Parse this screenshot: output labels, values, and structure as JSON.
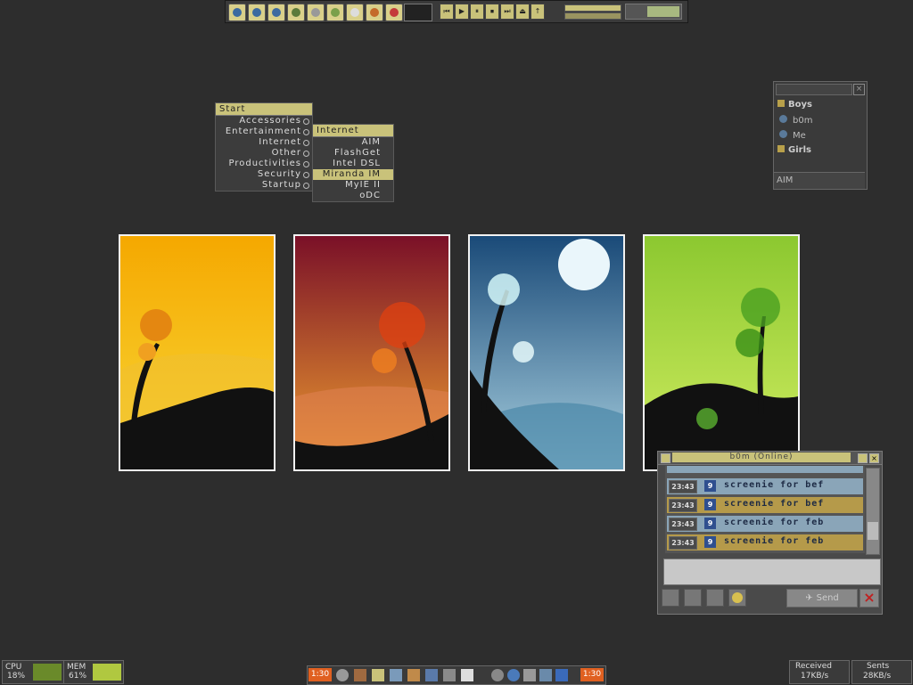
{
  "toolbar": {
    "launcher_icons": [
      "home-icon",
      "globe-icon",
      "chat-icon",
      "shield-icon",
      "disc-icon",
      "pen-icon",
      "calendar-icon",
      "guitar-icon",
      "flower-icon"
    ],
    "media_buttons": [
      "⏮",
      "▶",
      "⏸",
      "⏹",
      "⏭",
      "⏏",
      "↑"
    ]
  },
  "start_menu": {
    "title": "Start",
    "items": [
      "Accessories",
      "Entertainment",
      "Internet",
      "Other",
      "Productivities",
      "Security",
      "Startup"
    ],
    "submenu": {
      "title": "Internet",
      "items": [
        "AIM",
        "FlashGet",
        "Intel DSL",
        "Miranda IM",
        "MyIE II",
        "oDC"
      ],
      "selected": "Miranda IM"
    }
  },
  "contact_list": {
    "groups": [
      {
        "name": "Boys",
        "contacts": [
          "b0m",
          "Me"
        ]
      },
      {
        "name": "Girls",
        "contacts": []
      }
    ],
    "status": "AIM"
  },
  "chat_window": {
    "title": "b0m  (Online)",
    "messages": [
      {
        "time": "23:43",
        "icon": "9",
        "text": "screenie for bef",
        "style": "blue"
      },
      {
        "time": "23:43",
        "icon": "9",
        "text": "screenie for bef",
        "style": "gold"
      },
      {
        "time": "23:43",
        "icon": "9",
        "text": "screenie for feb",
        "style": "blue"
      },
      {
        "time": "23:43",
        "icon": "9",
        "text": "screenie for feb",
        "style": "gold"
      }
    ],
    "send_label": "Send"
  },
  "system": {
    "cpu_label": "CPU",
    "cpu_value": "18%",
    "mem_label": "MEM",
    "mem_value": "61%",
    "received_label": "Received",
    "received_value": "17KB/s",
    "sent_label": "Sents",
    "sent_value": "28KB/s"
  },
  "taskbar": {
    "clock_left": "1:30",
    "clock_right": "1:30"
  },
  "colors": {
    "accent": "#c9c27a",
    "msg_blue": "#8aa5b8",
    "msg_gold": "#b59a4a"
  }
}
